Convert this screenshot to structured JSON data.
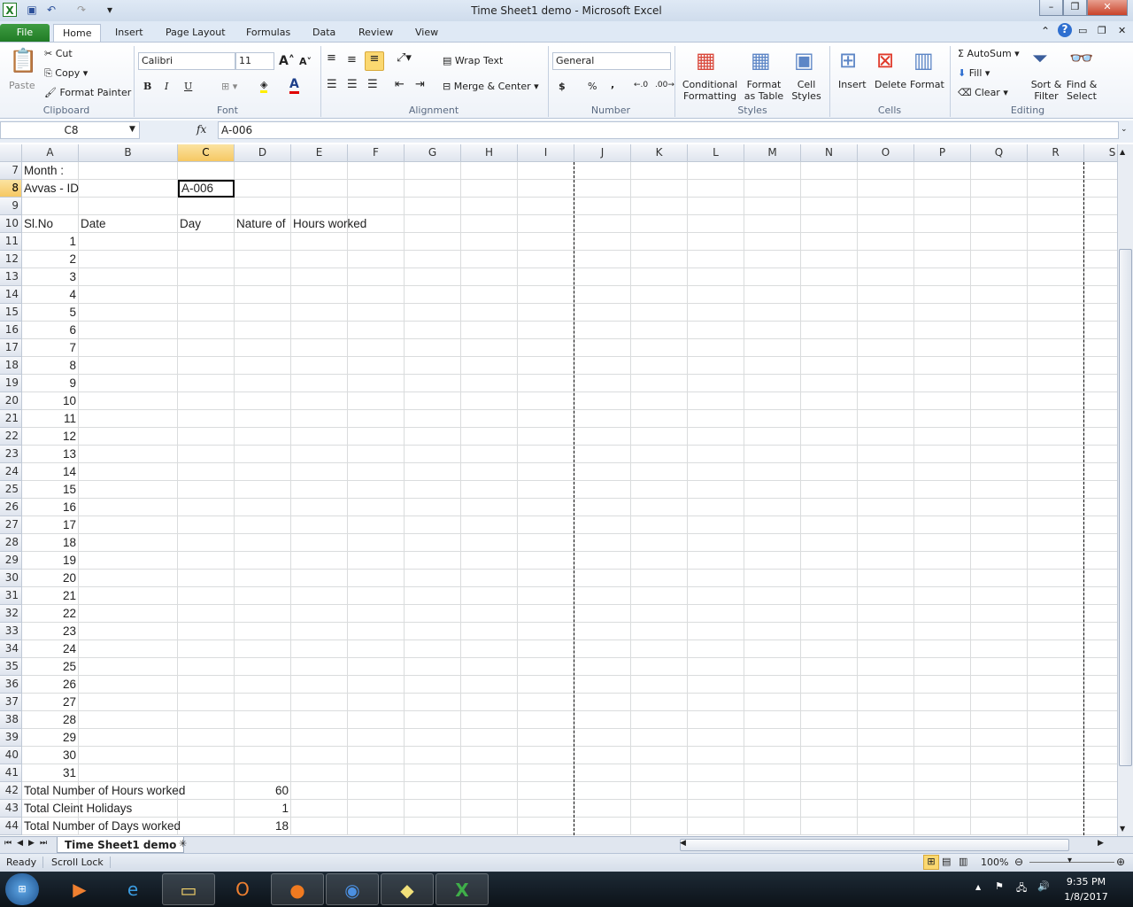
{
  "window": {
    "title": "Time Sheet1 demo  -  Microsoft Excel"
  },
  "ribbon_tabs": [
    "File",
    "Home",
    "Insert",
    "Page Layout",
    "Formulas",
    "Data",
    "Review",
    "View"
  ],
  "clipboard": {
    "paste": "Paste",
    "cut": "Cut",
    "copy": "Copy",
    "format_painter": "Format Painter",
    "label": "Clipboard"
  },
  "font": {
    "name": "Calibri",
    "size": "11",
    "bold": "B",
    "italic": "I",
    "underline": "U",
    "label": "Font"
  },
  "alignment": {
    "wrap": "Wrap Text",
    "merge": "Merge & Center",
    "label": "Alignment"
  },
  "number": {
    "format": "General",
    "currency": "$",
    "percent": "%",
    "comma": ",",
    "label": "Number"
  },
  "styles": {
    "conditional": "Conditional",
    "conditional2": "Formatting",
    "format_table": "Format",
    "format_table2": "as Table",
    "cell_styles": "Cell",
    "cell_styles2": "Styles",
    "label": "Styles"
  },
  "cells_group": {
    "insert": "Insert",
    "delete": "Delete",
    "format": "Format",
    "label": "Cells"
  },
  "editing": {
    "autosum": "AutoSum",
    "fill": "Fill",
    "clear": "Clear",
    "sort": "Sort &",
    "sort2": "Filter",
    "find": "Find &",
    "find2": "Select",
    "label": "Editing"
  },
  "formula_bar": {
    "name_box": "C8",
    "fx": "fx",
    "value": "A-006"
  },
  "sheet": {
    "columns": [
      "A",
      "B",
      "C",
      "D",
      "E",
      "F",
      "G",
      "H",
      "I",
      "J",
      "K",
      "L",
      "M",
      "N",
      "O",
      "P",
      "Q",
      "R",
      "S"
    ],
    "selected_col": "C",
    "selected_row": 8,
    "rows": [
      7,
      8,
      9,
      10,
      11,
      12,
      13,
      14,
      15,
      16,
      17,
      18,
      19,
      20,
      21,
      22,
      23,
      24,
      25,
      26,
      27,
      28,
      29,
      30,
      31,
      32,
      33,
      34,
      35,
      36,
      37,
      38,
      39,
      40,
      41,
      42,
      43,
      44
    ],
    "cells": {
      "A7": "Month :",
      "A8": "Avvas - ID",
      "C8": "A-006",
      "A10": "Sl.No",
      "B10": "Date",
      "C10": "Day",
      "D10": "Nature of",
      "E10": "Hours worked",
      "A11": "1",
      "A12": "2",
      "A13": "3",
      "A14": "4",
      "A15": "5",
      "A16": "6",
      "A17": "7",
      "A18": "8",
      "A19": "9",
      "A20": "10",
      "A21": "11",
      "A22": "12",
      "A23": "13",
      "A24": "14",
      "A25": "15",
      "A26": "16",
      "A27": "17",
      "A28": "18",
      "A29": "19",
      "A30": "20",
      "A31": "21",
      "A32": "22",
      "A33": "23",
      "A34": "24",
      "A35": "25",
      "A36": "26",
      "A37": "27",
      "A38": "28",
      "A39": "29",
      "A40": "30",
      "A41": "31",
      "A42": "Total Number of Hours worked",
      "D42": "60",
      "A43": "Total Cleint Holidays",
      "D43": "1",
      "A44": "Total Number of Days worked",
      "D44": "18"
    },
    "numeric_cells": [
      "A11",
      "A12",
      "A13",
      "A14",
      "A15",
      "A16",
      "A17",
      "A18",
      "A19",
      "A20",
      "A21",
      "A22",
      "A23",
      "A24",
      "A25",
      "A26",
      "A27",
      "A28",
      "A29",
      "A30",
      "A31",
      "A32",
      "A33",
      "A34",
      "A35",
      "A36",
      "A37",
      "A38",
      "A39",
      "A40",
      "A41",
      "D42",
      "D43",
      "D44"
    ]
  },
  "sheet_tab": "Time Sheet1 demo",
  "status": {
    "ready": "Ready",
    "scroll_lock": "Scroll Lock",
    "zoom": "100%"
  },
  "taskbar": {
    "time": "9:35 PM",
    "date": "1/8/2017"
  },
  "colors": {
    "accent": "#1f7a24",
    "selected_header": "#f6c863"
  }
}
